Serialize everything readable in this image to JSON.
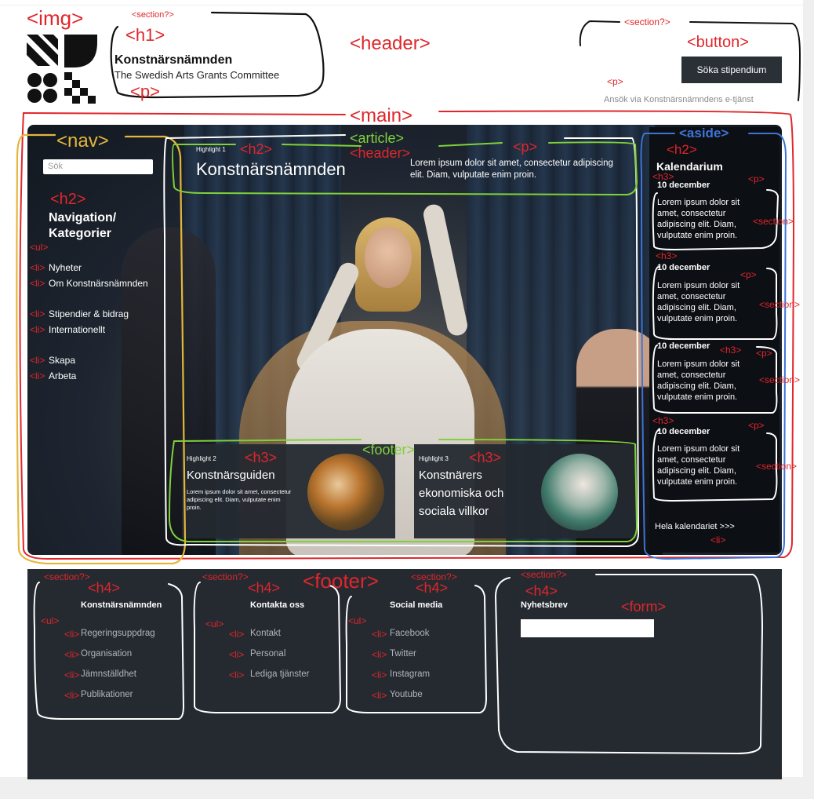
{
  "annotations": {
    "img": "<img>",
    "section_logo": "<section?>",
    "h1": "<h1>",
    "p_logo": "<p>",
    "header": "<header>",
    "section_button": "<section?>",
    "button": "<button>",
    "p_button": "<p>",
    "main": "<main>",
    "nav": "<nav>",
    "h2_nav": "<h2>",
    "ul_nav": "<ul>",
    "li": "<li>",
    "article": "<article>",
    "h2_article": "<h2>",
    "header_article": "<header>",
    "p_article": "<p>",
    "aside": "<aside>",
    "h2_aside": "<h2>",
    "h3": "<h3>",
    "p": "<p>",
    "section": "<section>",
    "footer_article": "<footer>",
    "h3_card1": "<h3>",
    "h3_card2": "<h3>",
    "footer": "<footer>",
    "section_q": "<section?>",
    "h4": "<h4>",
    "ul": "<ul>",
    "form": "<form>"
  },
  "header": {
    "title": "Konstnärsnämnden",
    "subtitle": "The Swedish Arts Grants Committee",
    "button_label": "Söka stipendium",
    "button_note": "Ansök via Konstnärsnämndens e-tjänst"
  },
  "nav": {
    "search_placeholder": "Sök",
    "heading": "Navigation/ Kategorier",
    "items": [
      "Nyheter",
      "Om Konstnärsnämnden",
      "Stipendier & bidrag",
      "Internationellt",
      "Skapa",
      "Arbeta"
    ]
  },
  "article": {
    "highlight_label": "Highlight 1",
    "title": "Konstnärsnämnden",
    "text": "Lorem ipsum dolor sit amet, consectetur adipiscing elit. Diam, vulputate enim proin.",
    "cards": [
      {
        "label": "Highlight 2",
        "title": "Konstnärsguiden",
        "text": "Lorem ipsum dolor sit amet, consectetur adipiscing elit. Diam, vulputate enim proin."
      },
      {
        "label": "Highlight 3",
        "title": "Konstnärers ekonomiska och sociala villkor"
      }
    ]
  },
  "aside": {
    "heading": "Kalendarium",
    "events": [
      {
        "date": "10 december",
        "text": "Lorem ipsum dolor sit amet, consectetur adipiscing elit. Diam, vulputate enim proin."
      },
      {
        "date": "10 december",
        "text": "Lorem ipsum dolor sit amet, consectetur adipiscing elit. Diam, vulputate enim proin."
      },
      {
        "date": "10 december",
        "text": "Lorem ipsum dolor sit amet, consectetur adipiscing elit. Diam, vulputate enim proin."
      },
      {
        "date": "10 december",
        "text": "Lorem ipsum dolor sit amet, consectetur adipiscing elit. Diam, vulputate enim proin."
      }
    ],
    "all_link": "Hela kalendariet >>>"
  },
  "footer": {
    "col1": {
      "heading": "Konstnärsnämnden",
      "items": [
        "Regeringsuppdrag",
        "Organisation",
        "Jämnställdhet",
        "Publikationer"
      ]
    },
    "col2": {
      "heading": "Kontakta oss",
      "items": [
        "Kontakt",
        "Personal",
        "Lediga tjänster"
      ]
    },
    "col3": {
      "heading": "Social media",
      "items": [
        "Facebook",
        "Twitter",
        "Instagram",
        "Youtube"
      ]
    },
    "col4": {
      "heading": "Nyhetsbrev"
    }
  },
  "colors": {
    "annotation_red": "#e0262b",
    "nav_yellow": "#e3b73c",
    "article_green": "#7fd13a",
    "aside_blue": "#3e74d6",
    "dark": "#252a31"
  }
}
